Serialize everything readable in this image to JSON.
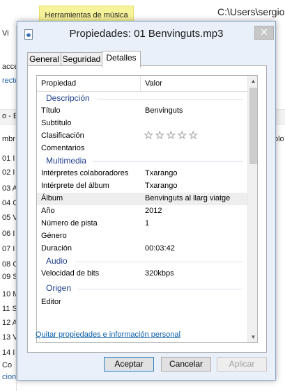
{
  "background": {
    "tools_tab": "Herramientas de música",
    "path_title": "C:\\Users\\sergio",
    "left_fragments": [
      "Vi",
      "acces",
      "recto",
      "o - B",
      "mbr",
      "01 I",
      "02 I",
      "03 A",
      "04 C",
      "05 V",
      "06 I",
      "07 I",
      "08 C",
      "09 S",
      "10 M",
      "11 S",
      "12 A",
      "13 V",
      "14 I",
      "Co",
      "cion"
    ],
    "right_fragments": [
      "olo"
    ]
  },
  "dialog": {
    "title": "Propiedades: 01 Benvinguts.mp3",
    "close_label": "✕",
    "tabs": [
      "General",
      "Seguridad",
      "Detalles"
    ],
    "active_tab": "Detalles",
    "columns": {
      "property": "Propiedad",
      "value": "Valor"
    },
    "groups": {
      "description": "Descripción",
      "multimedia": "Multimedia",
      "audio": "Audio",
      "origin": "Origen"
    },
    "rows": {
      "title": {
        "label": "Título",
        "value": "Benvinguts"
      },
      "subtitle": {
        "label": "Subtítulo",
        "value": ""
      },
      "rating": {
        "label": "Clasificación",
        "stars": 0,
        "max_stars": 5
      },
      "comments": {
        "label": "Comentarios",
        "value": ""
      },
      "contributing_artists": {
        "label": "Intérpretes colaboradores",
        "value": "Txarango"
      },
      "album_artist": {
        "label": "Intérprete del álbum",
        "value": "Txarango"
      },
      "album": {
        "label": "Álbum",
        "value": "Benvinguts al llarg viatge"
      },
      "year": {
        "label": "Año",
        "value": "2012"
      },
      "track": {
        "label": "Número de pista",
        "value": "1"
      },
      "genre": {
        "label": "Género",
        "value": ""
      },
      "duration": {
        "label": "Duración",
        "value": "00:03:42"
      },
      "bitrate": {
        "label": "Velocidad de bits",
        "value": "320kbps"
      },
      "publisher": {
        "label": "Editor",
        "value": ""
      }
    },
    "remove_link": "Quitar propiedades e información personal",
    "buttons": {
      "accept": "Aceptar",
      "cancel": "Cancelar",
      "apply": "Aplicar"
    }
  },
  "colors": {
    "tools_tab_bg": "#f7f39a",
    "dialog_bg": "#e9f0f9",
    "group_heading": "#1e3f8c",
    "link": "#0b5ea8"
  }
}
